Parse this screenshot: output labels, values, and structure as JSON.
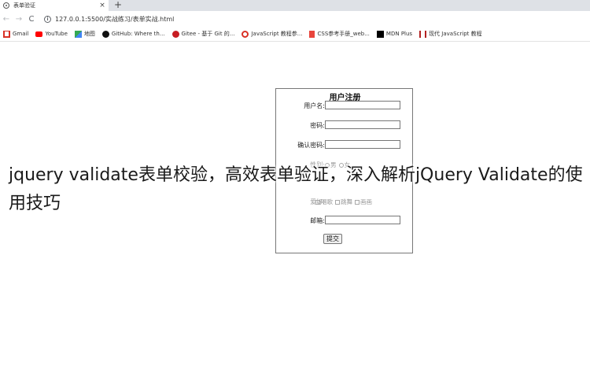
{
  "browser": {
    "tab_title": "表单验证",
    "tab_close": "×",
    "new_tab": "+",
    "back": "←",
    "forward": "→",
    "reload": "C",
    "url": "127.0.0.1:5500/实战练习/表单实战.html"
  },
  "bookmarks": [
    {
      "label": "Gmail",
      "icon": "gmail-icon",
      "color": "#d93025"
    },
    {
      "label": "YouTube",
      "icon": "youtube-icon",
      "color": "#ff0000"
    },
    {
      "label": "地图",
      "icon": "maps-icon",
      "color": "#34a853"
    },
    {
      "label": "GitHub: Where th...",
      "icon": "github-icon",
      "color": "#111111"
    },
    {
      "label": "Gitee - 基于 Git 的...",
      "icon": "gitee-icon",
      "color": "#c71d23"
    },
    {
      "label": "JavaScript 教程参...",
      "icon": "javascript-icon",
      "color": "#d93025"
    },
    {
      "label": "CSS参考手册_web...",
      "icon": "css-icon",
      "color": "#e8453c"
    },
    {
      "label": "MDN Plus",
      "icon": "mdn-icon",
      "color": "#000000"
    },
    {
      "label": "现代 JavaScript 教程",
      "icon": "modern-js-icon",
      "color": "#b22222"
    }
  ],
  "form": {
    "title": "用户注册",
    "username_label": "用户名:",
    "password_label": "密码:",
    "confirm_label": "确认密码:",
    "gender_label": "性别:",
    "gender_options": [
      "男",
      "女"
    ],
    "hidden_row_label": "",
    "hobby_label": "爱好:",
    "hobby_options": [
      "唱歌",
      "跳舞",
      "画画"
    ],
    "email_label": "邮箱:",
    "submit_label": "提交"
  },
  "overlay": {
    "caption": "jquery validate表单校验，高效表单验证，深入解析jQuery Validate的使用技巧"
  }
}
